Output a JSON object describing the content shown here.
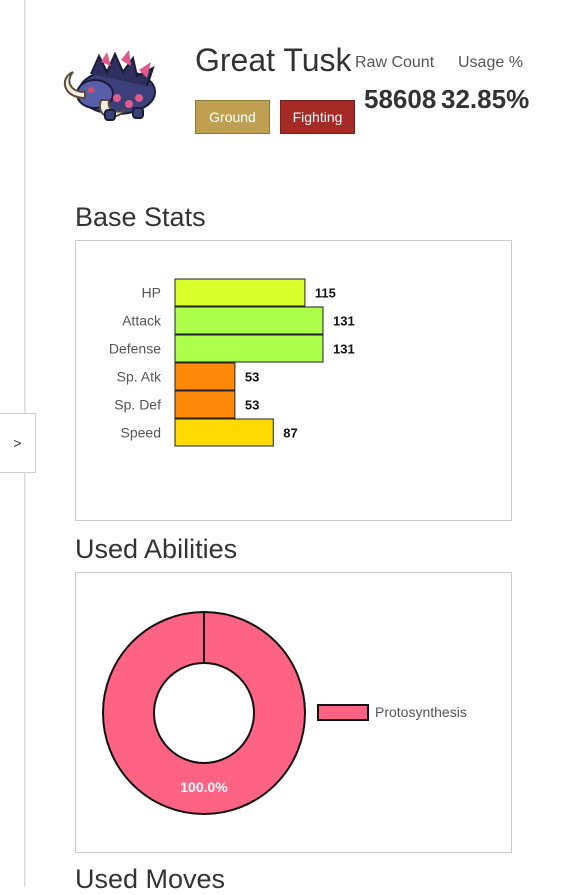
{
  "sidebar": {
    "toggle_label": ">"
  },
  "pokemon": {
    "name": "Great Tusk",
    "types": [
      {
        "label": "Ground",
        "color": "#bfa052"
      },
      {
        "label": "Fighting",
        "color": "#a52a25"
      }
    ],
    "sprite_icon": "great-tusk-sprite"
  },
  "usage": {
    "raw_count_label": "Raw Count",
    "usage_label": "Usage %",
    "raw_count": "58608",
    "usage_percent": "32.85%"
  },
  "sections": {
    "base_stats": "Base Stats",
    "used_abilities": "Used Abilities",
    "used_moves": "Used Moves"
  },
  "chart_data": [
    {
      "type": "bar",
      "orientation": "horizontal",
      "categories": [
        "HP",
        "Attack",
        "Defense",
        "Sp. Atk",
        "Sp. Def",
        "Speed"
      ],
      "values": [
        115,
        131,
        131,
        53,
        53,
        87
      ],
      "colors": [
        "#d8ff2c",
        "#acff4a",
        "#acff4a",
        "#ff8a0a",
        "#ff8a0a",
        "#ffd900"
      ],
      "data_labels": true,
      "grid": false
    },
    {
      "type": "pie",
      "style": "doughnut",
      "labels": [
        "Protosynthesis"
      ],
      "values": [
        100.0
      ],
      "slice_labels": [
        "100.0%"
      ],
      "colors": [
        "#ff6384"
      ],
      "legend_position": "right"
    }
  ]
}
